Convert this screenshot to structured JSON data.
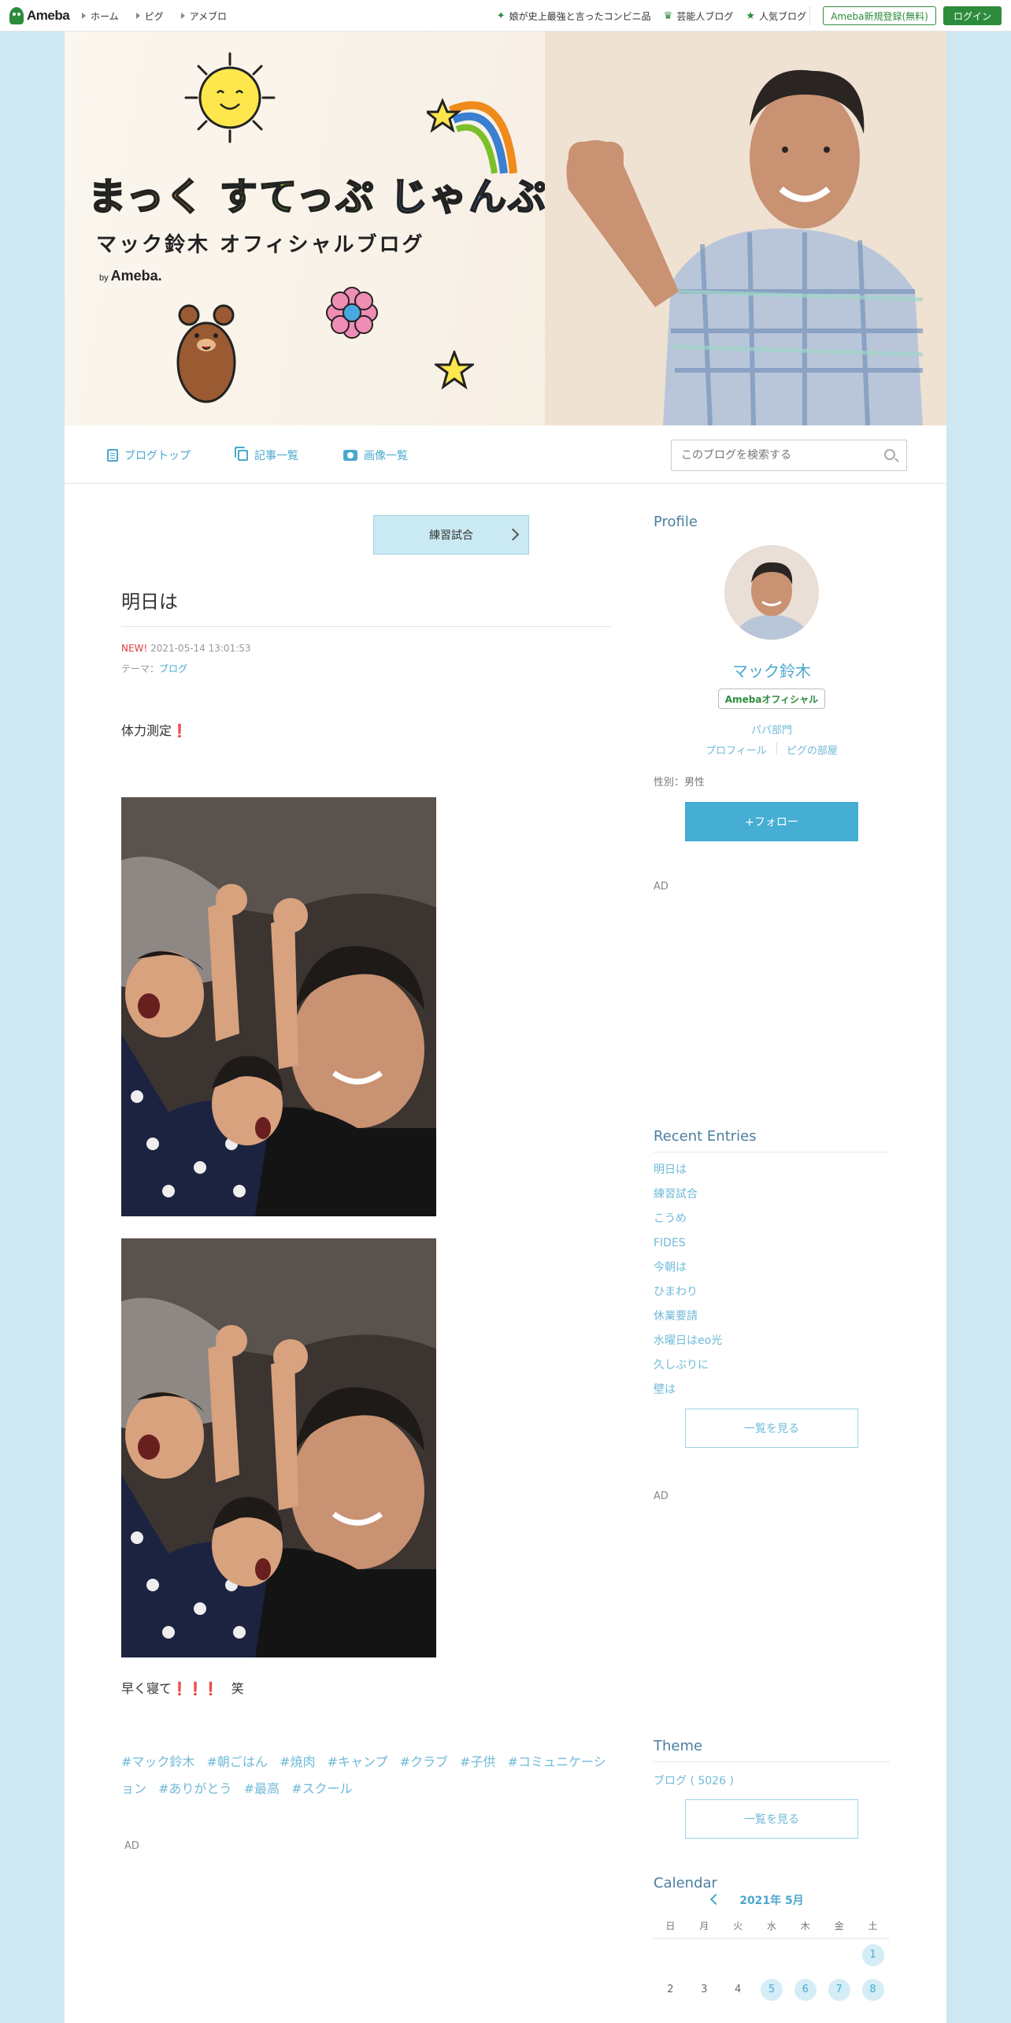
{
  "topbar": {
    "logo": "Ameba",
    "nav": [
      "ホーム",
      "ピグ",
      "アメブロ"
    ],
    "right_links": [
      {
        "icon": "sparkle-icon",
        "label": "娘が史上最強と言ったコンビニ品"
      },
      {
        "icon": "crown-icon",
        "label": "芸能人ブログ"
      },
      {
        "icon": "star-icon",
        "label": "人気ブログ"
      }
    ],
    "register_label": "Ameba新規登録(無料)",
    "login_label": "ログイン"
  },
  "banner": {
    "title_part1": "まっく",
    "title_part2": "すてっぷ",
    "title_part3": "じゃんぷ",
    "subtitle": "マック鈴木 オフィシャルブログ",
    "by_prefix": "by",
    "by_brand": "Ameba."
  },
  "blog_nav": {
    "items": [
      "ブログトップ",
      "記事一覧",
      "画像一覧"
    ],
    "search_placeholder": "このブログを検索する"
  },
  "article": {
    "theme_button": "練習試合",
    "title": "明日は",
    "new_label": "NEW!",
    "datetime": "2021-05-14 13:01:53",
    "theme_prefix": "テーマ：",
    "theme_name": "ブログ",
    "text1": "体力測定",
    "text1_mark": "❗",
    "text2": "早く寝て",
    "text2_mark": "❗❗❗",
    "text2_suffix": "　笑",
    "hashtags": [
      "#マック鈴木",
      "#朝ごはん",
      "#焼肉",
      "#キャンプ",
      "#クラブ",
      "#子供",
      "#コミュニケーション",
      "#ありがとう",
      "#最高",
      "#スクール"
    ],
    "ad_label": "AD"
  },
  "sidebar": {
    "profile_heading": "Profile",
    "profile_name": "マック鈴木",
    "official_badge": "Amebaオフィシャル",
    "category": "パパ部門",
    "links": [
      "プロフィール",
      "ピグの部屋"
    ],
    "gender": "性別：男性",
    "follow_label": "+フォロー",
    "ad_label": "AD",
    "recent_heading": "Recent Entries",
    "recent_entries": [
      "明日は",
      "練習試合",
      "こうめ",
      "FIDES",
      "今朝は",
      "ひまわり",
      "休業要請",
      "水曜日はeo光",
      "久しぶりに",
      "壁は"
    ],
    "more_label": "一覧を見る",
    "theme_heading": "Theme",
    "theme_item": "ブログ ( 5026 )",
    "calendar_heading": "Calendar",
    "calendar_month": "2021年 5月",
    "weekdays": [
      "日",
      "月",
      "火",
      "水",
      "木",
      "金",
      "土"
    ],
    "weeks": [
      [
        "",
        "",
        "",
        "",
        "",
        "",
        "1"
      ],
      [
        "2",
        "3",
        "4",
        "5",
        "6",
        "7",
        "8"
      ]
    ],
    "highlighted_days": [
      "1",
      "5",
      "6",
      "7",
      "8"
    ]
  },
  "colors": {
    "ameba_green": "#2d8c3c",
    "link_blue": "#4aa8cd",
    "page_bg": "#cde8f0",
    "follow_button": "#45aed2",
    "new_red": "#e23b3b"
  }
}
